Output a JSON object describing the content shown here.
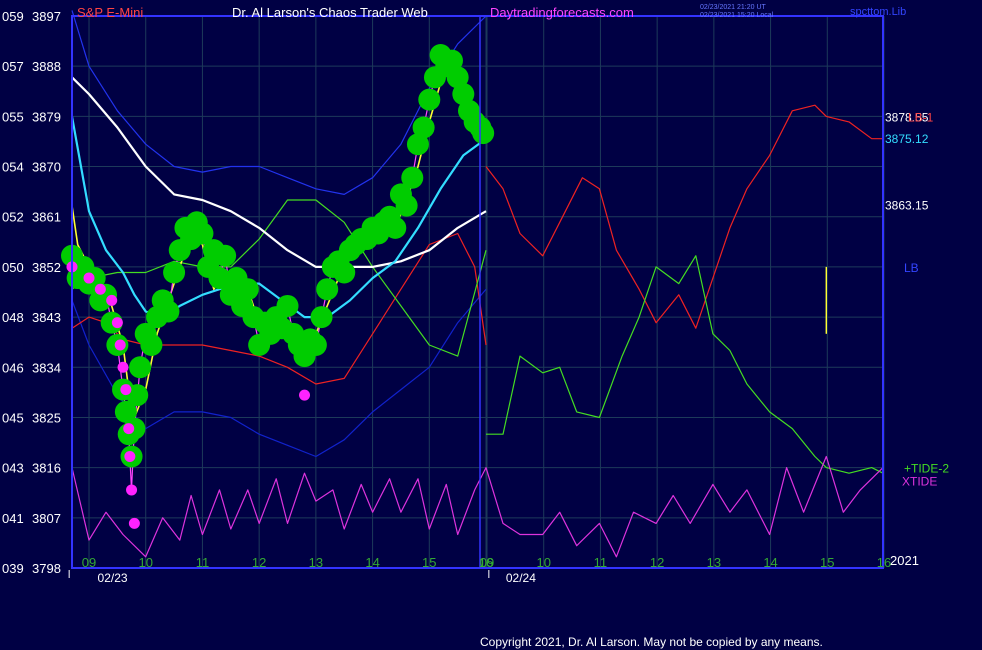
{
  "header": {
    "instrument": "S&P E-Mini",
    "site": "Dr. Al Larson's Chaos Trader Web",
    "url": "Daytradingforecasts.com",
    "stamp_utc": "02/23/2021 21:20 UT",
    "stamp_local": "02/23/2021 15:20 Local",
    "source": "spcttom.Lib"
  },
  "footer": {
    "copyright": "Copyright 2021, Dr. Al Larson. May not be copied by any means."
  },
  "colors": {
    "background": "#000044",
    "plot_border": "#3333ff",
    "grid": "#1d3a5a",
    "price": "#ff44ff",
    "dots": "#00cc00",
    "dots_low": "#ff22ff",
    "fast_avg": "#ffff33",
    "mid_avg": "#33ddff",
    "slow_avg": "#ffffff",
    "band": "#2233ee",
    "lower_band": "#1122cc",
    "lb_red": "#ee2222",
    "tide2": "#44dd22",
    "xtide": "#dd33dd"
  },
  "chart_data": {
    "type": "line",
    "x_unit": "hour (ET), 2021-02-23 09:00 to 2021-02-24 16:00",
    "y_unit": "price",
    "ylim": [
      3798,
      3897
    ],
    "grid": true,
    "left_ticks": [
      {
        "code": "059",
        "price": "3897"
      },
      {
        "code": "057",
        "price": "3888"
      },
      {
        "code": "055",
        "price": "3879"
      },
      {
        "code": "054",
        "price": "3870"
      },
      {
        "code": "052",
        "price": "3861"
      },
      {
        "code": "050",
        "price": "3852"
      },
      {
        "code": "048",
        "price": "3843"
      },
      {
        "code": "046",
        "price": "3834"
      },
      {
        "code": "045",
        "price": "3825"
      },
      {
        "code": "043",
        "price": "3816"
      },
      {
        "code": "041",
        "price": "3807"
      },
      {
        "code": "039",
        "price": "3798"
      }
    ],
    "hour_ticks": [
      "09",
      "10",
      "11",
      "12",
      "13",
      "14",
      "15",
      "16",
      "09",
      "10",
      "11",
      "12",
      "13",
      "14",
      "15",
      "16"
    ],
    "dates": [
      "02/23",
      "02/24"
    ],
    "year_label": "2021",
    "right_labels": [
      {
        "text": "3878.55",
        "price": 3879,
        "color": "#ffffff"
      },
      {
        "text": "LB-1",
        "price": 3879,
        "color": "#ff4444"
      },
      {
        "text": "3875.12",
        "price": 3875.12,
        "color": "#33ddff"
      },
      {
        "text": "3863.15",
        "price": 3863.15,
        "color": "#ffffff"
      },
      {
        "text": "LB",
        "price": 3852,
        "color": "#3344ff"
      },
      {
        "text": "+TIDE-2",
        "price": 3816,
        "color": "#44dd22"
      },
      {
        "text": "XTIDE",
        "price": 3814,
        "color": "#dd33dd"
      }
    ],
    "series": [
      {
        "key": "upper_band",
        "color": "#2233ee",
        "x": [
          8.7,
          9.0,
          9.5,
          10.0,
          10.5,
          11.0,
          11.5,
          12.0,
          12.5,
          13.0,
          13.5,
          14.0,
          14.5,
          15.0,
          15.5,
          16.0
        ],
        "y": [
          3898,
          3888,
          3880,
          3874,
          3870,
          3869,
          3870,
          3870,
          3868,
          3866,
          3865,
          3868,
          3874,
          3884,
          3892,
          3897
        ]
      },
      {
        "key": "lower_band",
        "color": "#1122cc",
        "x": [
          8.7,
          9.0,
          9.5,
          10.0,
          10.5,
          11.0,
          11.5,
          12.0,
          12.5,
          13.0,
          13.5,
          14.0,
          14.5,
          15.0,
          15.5,
          16.0
        ],
        "y": [
          3846,
          3838,
          3829,
          3823,
          3826,
          3826,
          3825,
          3822,
          3820,
          3818,
          3821,
          3826,
          3830,
          3834,
          3842,
          3848
        ]
      },
      {
        "key": "lb_red",
        "color": "#ee2222",
        "x": [
          8.7,
          9.0,
          9.3,
          9.6,
          10.0,
          10.5,
          11.0,
          11.5,
          12.0,
          12.5,
          13.0,
          13.5,
          14.0,
          14.5,
          15.0,
          15.5,
          15.8,
          16.0
        ],
        "y": [
          3841,
          3843,
          3842,
          3839,
          3838,
          3838,
          3838,
          3837,
          3836,
          3834,
          3831,
          3832,
          3840,
          3848,
          3856,
          3858,
          3852,
          3838
        ]
      },
      {
        "key": "tide2",
        "color": "#44dd22",
        "x": [
          8.7,
          9.0,
          9.5,
          10.0,
          10.5,
          11.0,
          11.5,
          12.0,
          12.5,
          13.0,
          13.5,
          14.0,
          14.5,
          15.0,
          15.5,
          16.0
        ],
        "y": [
          3848,
          3850,
          3851,
          3851,
          3853,
          3852,
          3852,
          3857,
          3864,
          3864,
          3860,
          3852,
          3845,
          3838,
          3836,
          3855
        ]
      },
      {
        "key": "slow_avg",
        "color": "#ffffff",
        "x": [
          8.7,
          9.0,
          9.5,
          10.0,
          10.5,
          11.0,
          11.5,
          12.0,
          12.5,
          13.0,
          13.5,
          14.0,
          14.5,
          15.0,
          15.5,
          16.0
        ],
        "y": [
          3886,
          3883,
          3877,
          3870,
          3865,
          3864,
          3862,
          3859,
          3855,
          3852,
          3852,
          3852,
          3853,
          3855,
          3859,
          3862
        ]
      },
      {
        "key": "mid_avg",
        "color": "#33ddff",
        "x": [
          8.7,
          9.0,
          9.3,
          9.6,
          9.8,
          10.0,
          10.3,
          10.6,
          11.0,
          11.3,
          11.6,
          12.0,
          12.4,
          12.8,
          13.2,
          13.6,
          14.0,
          14.4,
          14.8,
          15.2,
          15.6,
          16.0
        ],
        "y": [
          3879,
          3862,
          3855,
          3851,
          3847,
          3844,
          3843,
          3845,
          3847,
          3848,
          3849,
          3849,
          3846,
          3843,
          3843,
          3846,
          3850,
          3853,
          3859,
          3866,
          3872,
          3875
        ]
      },
      {
        "key": "fast_avg",
        "color": "#ffff33",
        "x": [
          8.7,
          8.8,
          9.0,
          9.2,
          9.4,
          9.6,
          9.7,
          9.8,
          10.0,
          10.2,
          10.4,
          10.6,
          10.8,
          11.0,
          11.2,
          11.4,
          11.6,
          11.8,
          12.0,
          12.2,
          12.4,
          12.6,
          12.8,
          13.0,
          13.2,
          13.4,
          13.6,
          13.8,
          14.0,
          14.2,
          14.4,
          14.6,
          14.8,
          15.0,
          15.2,
          15.4,
          15.6,
          15.8,
          16.0
        ],
        "y": [
          3863,
          3856,
          3852,
          3848,
          3845,
          3838,
          3830,
          3825,
          3830,
          3840,
          3846,
          3852,
          3858,
          3856,
          3848,
          3851,
          3845,
          3848,
          3842,
          3840,
          3843,
          3839,
          3837,
          3840,
          3845,
          3850,
          3854,
          3856,
          3856,
          3858,
          3859,
          3864,
          3870,
          3878,
          3885,
          3888,
          3884,
          3878,
          3876
        ]
      },
      {
        "key": "price",
        "color": "#ff44ff",
        "x": [
          8.7,
          8.8,
          8.9,
          9.0,
          9.1,
          9.2,
          9.3,
          9.4,
          9.5,
          9.6,
          9.7,
          9.75,
          9.8,
          9.9,
          10.0,
          10.1,
          10.2,
          10.3,
          10.4,
          10.5,
          10.6,
          10.7,
          10.8,
          10.9,
          11.0,
          11.1,
          11.2,
          11.3,
          11.4,
          11.5,
          11.6,
          11.7,
          11.8,
          11.9,
          12.0,
          12.1,
          12.2,
          12.3,
          12.4,
          12.5,
          12.6,
          12.7,
          12.8,
          12.9,
          13.0,
          13.1,
          13.2,
          13.3,
          13.4,
          13.5,
          13.6,
          13.7,
          13.8,
          13.9,
          14.0,
          14.1,
          14.2,
          14.3,
          14.4,
          14.5,
          14.6,
          14.7,
          14.8,
          14.9,
          15.0,
          15.1,
          15.2,
          15.3,
          15.4,
          15.5,
          15.6,
          15.7,
          15.8,
          15.9,
          16.0
        ],
        "y": [
          3854,
          3850,
          3852,
          3849,
          3850,
          3846,
          3847,
          3842,
          3838,
          3830,
          3822,
          3812,
          3823,
          3834,
          3840,
          3838,
          3843,
          3846,
          3844,
          3851,
          3855,
          3859,
          3857,
          3860,
          3858,
          3852,
          3855,
          3850,
          3854,
          3847,
          3850,
          3845,
          3848,
          3843,
          3838,
          3842,
          3840,
          3843,
          3841,
          3845,
          3840,
          3838,
          3836,
          3839,
          3838,
          3843,
          3848,
          3852,
          3853,
          3851,
          3855,
          3856,
          3857,
          3857,
          3859,
          3858,
          3860,
          3861,
          3859,
          3865,
          3863,
          3868,
          3874,
          3877,
          3882,
          3886,
          3890,
          3888,
          3889,
          3886,
          3883,
          3880,
          3878,
          3877,
          3876
        ]
      },
      {
        "key": "lb1_forecast",
        "color": "#ee2222",
        "x": [
          16.0,
          16.3,
          16.6,
          17.0,
          17.4,
          17.7,
          18.0,
          18.3,
          18.7,
          19.0,
          19.4,
          19.7,
          20.0,
          20.3,
          20.6,
          21.0,
          21.4,
          21.8,
          22.0,
          22.4,
          22.8,
          23.0
        ],
        "y": [
          3870,
          3866,
          3858,
          3854,
          3862,
          3868,
          3866,
          3855,
          3848,
          3842,
          3847,
          3841,
          3850,
          3859,
          3866,
          3872,
          3880,
          3881,
          3879,
          3878,
          3875,
          3875
        ]
      },
      {
        "key": "tide2_forecast",
        "color": "#44dd22",
        "x": [
          16.0,
          16.3,
          16.6,
          17.0,
          17.3,
          17.6,
          18.0,
          18.4,
          18.7,
          19.0,
          19.4,
          19.7,
          20.0,
          20.3,
          20.6,
          21.0,
          21.4,
          21.8,
          22.0,
          22.4,
          22.8,
          23.0
        ],
        "y": [
          3822,
          3822,
          3836,
          3833,
          3834,
          3826,
          3825,
          3836,
          3843,
          3852,
          3849,
          3854,
          3840,
          3837,
          3831,
          3826,
          3823,
          3818,
          3816,
          3815,
          3816,
          3815
        ]
      },
      {
        "key": "xtide",
        "color": "#dd33dd",
        "x": [
          8.7,
          9.0,
          9.3,
          9.6,
          10.0,
          10.3,
          10.6,
          10.8,
          11.0,
          11.3,
          11.5,
          11.8,
          12.0,
          12.3,
          12.5,
          12.8,
          13.0,
          13.3,
          13.5,
          13.8,
          14.0,
          14.3,
          14.5,
          14.8,
          15.0,
          15.3,
          15.5,
          15.8,
          16.0,
          16.3,
          16.6,
          17.0,
          17.3,
          17.6,
          18.0,
          18.3,
          18.6,
          19.0,
          19.3,
          19.6,
          20.0,
          20.3,
          20.6,
          21.0,
          21.3,
          21.6,
          22.0,
          22.3,
          22.6,
          23.0
        ],
        "y": [
          3816,
          3803,
          3808,
          3804,
          3800,
          3807,
          3803,
          3811,
          3804,
          3812,
          3805,
          3812,
          3806,
          3814,
          3806,
          3815,
          3810,
          3812,
          3805,
          3813,
          3808,
          3814,
          3808,
          3814,
          3805,
          3813,
          3804,
          3812,
          3816,
          3806,
          3804,
          3804,
          3808,
          3802,
          3806,
          3800,
          3808,
          3806,
          3811,
          3806,
          3813,
          3808,
          3812,
          3804,
          3816,
          3808,
          3818,
          3808,
          3812,
          3816
        ]
      }
    ],
    "dot_series": {
      "green_x": [
        8.7,
        8.8,
        8.9,
        9.0,
        9.1,
        9.2,
        9.3,
        9.4,
        9.5,
        9.6,
        9.65,
        9.7,
        9.75,
        9.8,
        9.85,
        9.9,
        10.0,
        10.1,
        10.2,
        10.3,
        10.4,
        10.5,
        10.6,
        10.7,
        10.8,
        10.9,
        11.0,
        11.1,
        11.2,
        11.3,
        11.4,
        11.5,
        11.6,
        11.7,
        11.8,
        11.9,
        12.0,
        12.1,
        12.2,
        12.3,
        12.4,
        12.5,
        12.6,
        12.7,
        12.8,
        12.9,
        13.0,
        13.1,
        13.2,
        13.3,
        13.4,
        13.5,
        13.6,
        13.7,
        13.8,
        13.9,
        14.0,
        14.1,
        14.2,
        14.3,
        14.4,
        14.5,
        14.6,
        14.7,
        14.8,
        14.9,
        15.0,
        15.1,
        15.2,
        15.3,
        15.4,
        15.5,
        15.6,
        15.7,
        15.8,
        15.9,
        15.95
      ],
      "green_y": [
        3854,
        3850,
        3852,
        3849,
        3850,
        3846,
        3847,
        3842,
        3838,
        3830,
        3826,
        3822,
        3818,
        3823,
        3829,
        3834,
        3840,
        3838,
        3843,
        3846,
        3844,
        3851,
        3855,
        3859,
        3857,
        3860,
        3858,
        3852,
        3855,
        3850,
        3854,
        3847,
        3850,
        3845,
        3848,
        3843,
        3838,
        3842,
        3840,
        3843,
        3841,
        3845,
        3840,
        3838,
        3836,
        3839,
        3838,
        3843,
        3848,
        3852,
        3853,
        3851,
        3855,
        3856,
        3857,
        3857,
        3859,
        3858,
        3860,
        3861,
        3859,
        3865,
        3863,
        3868,
        3874,
        3877,
        3882,
        3886,
        3890,
        3888,
        3889,
        3886,
        3883,
        3880,
        3878,
        3877,
        3876
      ],
      "magenta_x": [
        8.7,
        9.0,
        9.2,
        9.4,
        9.5,
        9.55,
        9.6,
        9.65,
        9.7,
        9.72,
        9.75,
        9.8,
        12.8
      ],
      "magenta_y": [
        3852,
        3850,
        3848,
        3846,
        3842,
        3838,
        3834,
        3830,
        3823,
        3818,
        3812,
        3806,
        3829
      ]
    }
  }
}
